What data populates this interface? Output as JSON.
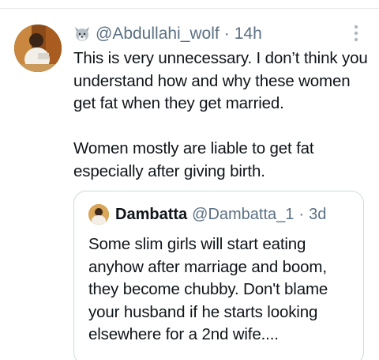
{
  "tweet": {
    "emoji_icon": "wolf-face-icon",
    "handle": "@Abdullahi_wolf",
    "separator": "·",
    "time": "14h",
    "more_icon": "more-vertical-icon",
    "text_paragraph_1": "This is very unnecessary. I don’t think you understand how and why these women get fat when they get married.",
    "text_paragraph_2": "Women mostly are liable to get fat especially after giving birth."
  },
  "quoted_tweet": {
    "display_name": "Dambatta",
    "handle": "@Dambatta_1",
    "separator": "·",
    "time": "3d",
    "text": "Some slim girls will start eating anyhow after marriage and boom, they become chubby. Don't blame your husband if he starts looking elsewhere for a 2nd wife...."
  },
  "colors": {
    "text_primary": "#0f1419",
    "text_secondary": "#5b7083",
    "border": "#cfd9de"
  }
}
